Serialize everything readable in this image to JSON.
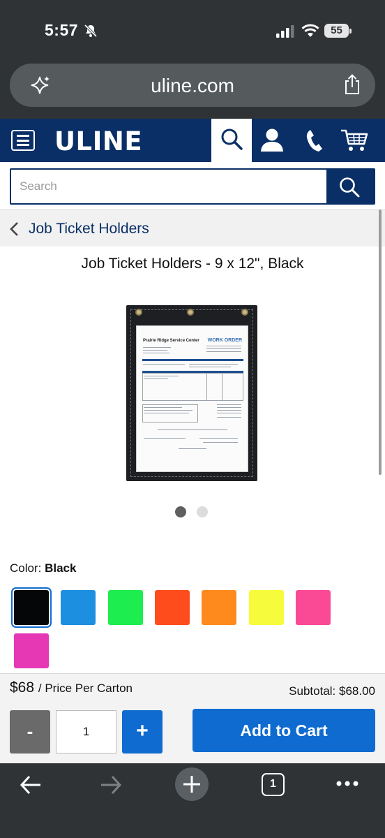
{
  "status_bar": {
    "time": "5:57",
    "battery": "55"
  },
  "browser": {
    "url": "uline.com",
    "tab_count": "1"
  },
  "header": {
    "logo": "ULINE"
  },
  "search": {
    "placeholder": "Search"
  },
  "breadcrumb": {
    "label": "Job Ticket Holders"
  },
  "product": {
    "title": "Job Ticket Holders - 9 x 12\", Black",
    "image": {
      "company": "Prairie Ridge Service Center",
      "heading": "WORK ORDER"
    },
    "carousel": {
      "images": 2,
      "active_index": 1
    }
  },
  "color": {
    "label": "Color:",
    "selected": "Black",
    "swatches": [
      {
        "name": "Black",
        "hex": "#050607"
      },
      {
        "name": "Blue",
        "hex": "#1d8fe0"
      },
      {
        "name": "Green",
        "hex": "#1ded4f"
      },
      {
        "name": "Red-Orange",
        "hex": "#fe4c1d"
      },
      {
        "name": "Orange",
        "hex": "#fe8a1d"
      },
      {
        "name": "Yellow",
        "hex": "#f6fb3b"
      },
      {
        "name": "Pink",
        "hex": "#fa4a96"
      },
      {
        "name": "Magenta",
        "hex": "#e637b4"
      }
    ]
  },
  "purchase": {
    "price": "$68",
    "price_unit": "/ Price Per Carton",
    "subtotal": "Subtotal: $68.00",
    "quantity": "1",
    "minus": "-",
    "plus": "+",
    "add_to_cart": "Add to Cart"
  },
  "colors": {
    "brand_navy": "#0a2f66",
    "action_blue": "#0f6bd0",
    "chrome_dark": "#2f3336"
  }
}
